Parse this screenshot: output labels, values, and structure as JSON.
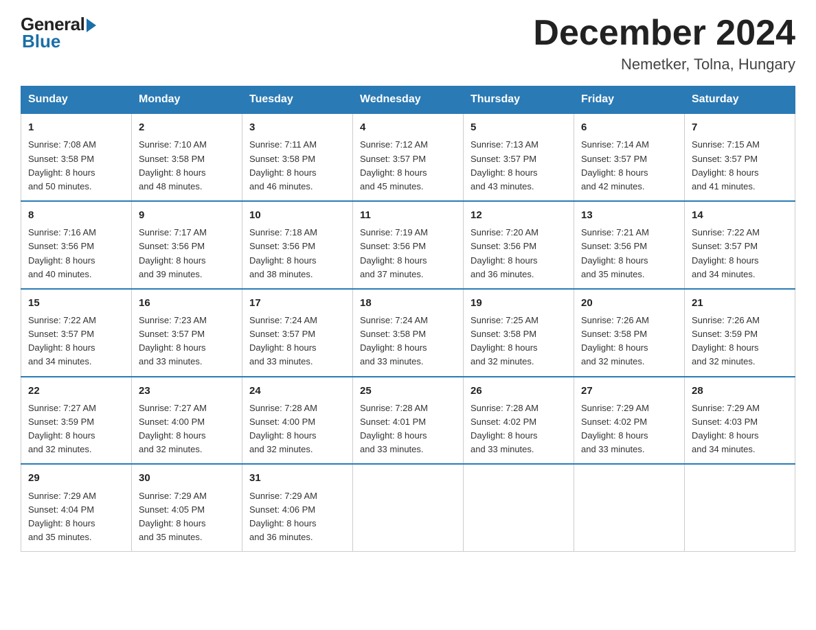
{
  "logo": {
    "general": "General",
    "blue": "Blue"
  },
  "header": {
    "title": "December 2024",
    "location": "Nemetker, Tolna, Hungary"
  },
  "weekdays": [
    "Sunday",
    "Monday",
    "Tuesday",
    "Wednesday",
    "Thursday",
    "Friday",
    "Saturday"
  ],
  "weeks": [
    [
      {
        "day": "1",
        "sunrise": "7:08 AM",
        "sunset": "3:58 PM",
        "daylight": "8 hours and 50 minutes."
      },
      {
        "day": "2",
        "sunrise": "7:10 AM",
        "sunset": "3:58 PM",
        "daylight": "8 hours and 48 minutes."
      },
      {
        "day": "3",
        "sunrise": "7:11 AM",
        "sunset": "3:58 PM",
        "daylight": "8 hours and 46 minutes."
      },
      {
        "day": "4",
        "sunrise": "7:12 AM",
        "sunset": "3:57 PM",
        "daylight": "8 hours and 45 minutes."
      },
      {
        "day": "5",
        "sunrise": "7:13 AM",
        "sunset": "3:57 PM",
        "daylight": "8 hours and 43 minutes."
      },
      {
        "day": "6",
        "sunrise": "7:14 AM",
        "sunset": "3:57 PM",
        "daylight": "8 hours and 42 minutes."
      },
      {
        "day": "7",
        "sunrise": "7:15 AM",
        "sunset": "3:57 PM",
        "daylight": "8 hours and 41 minutes."
      }
    ],
    [
      {
        "day": "8",
        "sunrise": "7:16 AM",
        "sunset": "3:56 PM",
        "daylight": "8 hours and 40 minutes."
      },
      {
        "day": "9",
        "sunrise": "7:17 AM",
        "sunset": "3:56 PM",
        "daylight": "8 hours and 39 minutes."
      },
      {
        "day": "10",
        "sunrise": "7:18 AM",
        "sunset": "3:56 PM",
        "daylight": "8 hours and 38 minutes."
      },
      {
        "day": "11",
        "sunrise": "7:19 AM",
        "sunset": "3:56 PM",
        "daylight": "8 hours and 37 minutes."
      },
      {
        "day": "12",
        "sunrise": "7:20 AM",
        "sunset": "3:56 PM",
        "daylight": "8 hours and 36 minutes."
      },
      {
        "day": "13",
        "sunrise": "7:21 AM",
        "sunset": "3:56 PM",
        "daylight": "8 hours and 35 minutes."
      },
      {
        "day": "14",
        "sunrise": "7:22 AM",
        "sunset": "3:57 PM",
        "daylight": "8 hours and 34 minutes."
      }
    ],
    [
      {
        "day": "15",
        "sunrise": "7:22 AM",
        "sunset": "3:57 PM",
        "daylight": "8 hours and 34 minutes."
      },
      {
        "day": "16",
        "sunrise": "7:23 AM",
        "sunset": "3:57 PM",
        "daylight": "8 hours and 33 minutes."
      },
      {
        "day": "17",
        "sunrise": "7:24 AM",
        "sunset": "3:57 PM",
        "daylight": "8 hours and 33 minutes."
      },
      {
        "day": "18",
        "sunrise": "7:24 AM",
        "sunset": "3:58 PM",
        "daylight": "8 hours and 33 minutes."
      },
      {
        "day": "19",
        "sunrise": "7:25 AM",
        "sunset": "3:58 PM",
        "daylight": "8 hours and 32 minutes."
      },
      {
        "day": "20",
        "sunrise": "7:26 AM",
        "sunset": "3:58 PM",
        "daylight": "8 hours and 32 minutes."
      },
      {
        "day": "21",
        "sunrise": "7:26 AM",
        "sunset": "3:59 PM",
        "daylight": "8 hours and 32 minutes."
      }
    ],
    [
      {
        "day": "22",
        "sunrise": "7:27 AM",
        "sunset": "3:59 PM",
        "daylight": "8 hours and 32 minutes."
      },
      {
        "day": "23",
        "sunrise": "7:27 AM",
        "sunset": "4:00 PM",
        "daylight": "8 hours and 32 minutes."
      },
      {
        "day": "24",
        "sunrise": "7:28 AM",
        "sunset": "4:00 PM",
        "daylight": "8 hours and 32 minutes."
      },
      {
        "day": "25",
        "sunrise": "7:28 AM",
        "sunset": "4:01 PM",
        "daylight": "8 hours and 33 minutes."
      },
      {
        "day": "26",
        "sunrise": "7:28 AM",
        "sunset": "4:02 PM",
        "daylight": "8 hours and 33 minutes."
      },
      {
        "day": "27",
        "sunrise": "7:29 AM",
        "sunset": "4:02 PM",
        "daylight": "8 hours and 33 minutes."
      },
      {
        "day": "28",
        "sunrise": "7:29 AM",
        "sunset": "4:03 PM",
        "daylight": "8 hours and 34 minutes."
      }
    ],
    [
      {
        "day": "29",
        "sunrise": "7:29 AM",
        "sunset": "4:04 PM",
        "daylight": "8 hours and 35 minutes."
      },
      {
        "day": "30",
        "sunrise": "7:29 AM",
        "sunset": "4:05 PM",
        "daylight": "8 hours and 35 minutes."
      },
      {
        "day": "31",
        "sunrise": "7:29 AM",
        "sunset": "4:06 PM",
        "daylight": "8 hours and 36 minutes."
      },
      null,
      null,
      null,
      null
    ]
  ],
  "labels": {
    "sunrise": "Sunrise:",
    "sunset": "Sunset:",
    "daylight": "Daylight:"
  }
}
